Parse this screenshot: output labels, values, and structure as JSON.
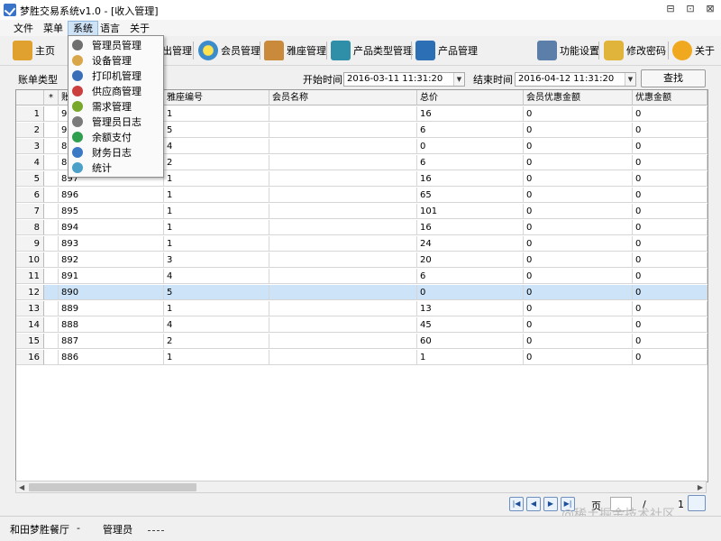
{
  "window": {
    "title": "梦胜交易系统v1.0 - [收入管理]",
    "controls": [
      "⊟",
      "⊡",
      "⊠"
    ]
  },
  "menubar": [
    "文件",
    "菜单",
    "系统",
    "语言",
    "关于"
  ],
  "toolbar": {
    "home": "主页",
    "out_manage": "出管理",
    "member": "会员管理",
    "seat": "雅座管理",
    "product_type": "产品类型管理",
    "product": "产品管理",
    "settings": "功能设置",
    "password": "修改密码",
    "about": "关于"
  },
  "filter": {
    "bill_type_label": "账单类型",
    "start_label": "开始时间",
    "start_value": "2016-03-11 11:31:20",
    "end_label": "结束时间",
    "end_value": "2016-04-12 11:31:20",
    "search_button": "查找"
  },
  "grid": {
    "columns": [
      "*",
      "账",
      "雅座编号",
      "会员名称",
      "总价",
      "会员优惠金额",
      "优惠金额"
    ],
    "rows": [
      {
        "n": "1",
        "id": "90",
        "seat": "1",
        "member": "",
        "total": "16",
        "member_discount": "0",
        "discount": "0"
      },
      {
        "n": "2",
        "id": "90",
        "seat": "5",
        "member": "",
        "total": "6",
        "member_discount": "0",
        "discount": "0"
      },
      {
        "n": "3",
        "id": "89",
        "seat": "4",
        "member": "",
        "total": "0",
        "member_discount": "0",
        "discount": "0"
      },
      {
        "n": "4",
        "id": "89",
        "seat": "2",
        "member": "",
        "total": "6",
        "member_discount": "0",
        "discount": "0"
      },
      {
        "n": "5",
        "id": "897",
        "seat": "1",
        "member": "",
        "total": "16",
        "member_discount": "0",
        "discount": "0"
      },
      {
        "n": "6",
        "id": "896",
        "seat": "1",
        "member": "",
        "total": "65",
        "member_discount": "0",
        "discount": "0"
      },
      {
        "n": "7",
        "id": "895",
        "seat": "1",
        "member": "",
        "total": "101",
        "member_discount": "0",
        "discount": "0"
      },
      {
        "n": "8",
        "id": "894",
        "seat": "1",
        "member": "",
        "total": "16",
        "member_discount": "0",
        "discount": "0"
      },
      {
        "n": "9",
        "id": "893",
        "seat": "1",
        "member": "",
        "total": "24",
        "member_discount": "0",
        "discount": "0"
      },
      {
        "n": "10",
        "id": "892",
        "seat": "3",
        "member": "",
        "total": "20",
        "member_discount": "0",
        "discount": "0"
      },
      {
        "n": "11",
        "id": "891",
        "seat": "4",
        "member": "",
        "total": "6",
        "member_discount": "0",
        "discount": "0"
      },
      {
        "n": "12",
        "id": "890",
        "seat": "5",
        "member": "",
        "total": "0",
        "member_discount": "0",
        "discount": "0",
        "selected": true
      },
      {
        "n": "13",
        "id": "889",
        "seat": "1",
        "member": "",
        "total": "13",
        "member_discount": "0",
        "discount": "0"
      },
      {
        "n": "14",
        "id": "888",
        "seat": "4",
        "member": "",
        "total": "45",
        "member_discount": "0",
        "discount": "0"
      },
      {
        "n": "15",
        "id": "887",
        "seat": "2",
        "member": "",
        "total": "60",
        "member_discount": "0",
        "discount": "0"
      },
      {
        "n": "16",
        "id": "886",
        "seat": "1",
        "member": "",
        "total": "1",
        "member_discount": "0",
        "discount": "0"
      }
    ]
  },
  "pager": {
    "page_label": "页",
    "slash": "/",
    "total_pages": "1",
    "buttons": [
      "first-page",
      "prev-page",
      "next-page",
      "last-page"
    ]
  },
  "status": {
    "restaurant": "和田梦胜餐厅",
    "sep1": "-",
    "role": "管理员",
    "sep2": "-"
  },
  "dropdown": {
    "items": [
      {
        "label": "管理员管理",
        "icon": "admin-icon",
        "color": "#6f6f6f"
      },
      {
        "label": "设备管理",
        "icon": "device-icon",
        "color": "#d9a74a"
      },
      {
        "label": "打印机管理",
        "icon": "printer-icon",
        "color": "#3a6fb8"
      },
      {
        "label": "供应商管理",
        "icon": "supplier-icon",
        "color": "#cc3f3f"
      },
      {
        "label": "需求管理",
        "icon": "demand-icon",
        "color": "#77a829"
      },
      {
        "label": "管理员日志",
        "icon": "log-icon",
        "color": "#7a7a7a"
      },
      {
        "label": "余额支付",
        "icon": "balance-icon",
        "color": "#2f9f4f"
      },
      {
        "label": "财务日志",
        "icon": "finance-icon",
        "color": "#3b79c4"
      },
      {
        "label": "统计",
        "icon": "stats-icon",
        "color": "#4aa0c8"
      }
    ]
  },
  "watermark": "@稀土掘金技术社区"
}
